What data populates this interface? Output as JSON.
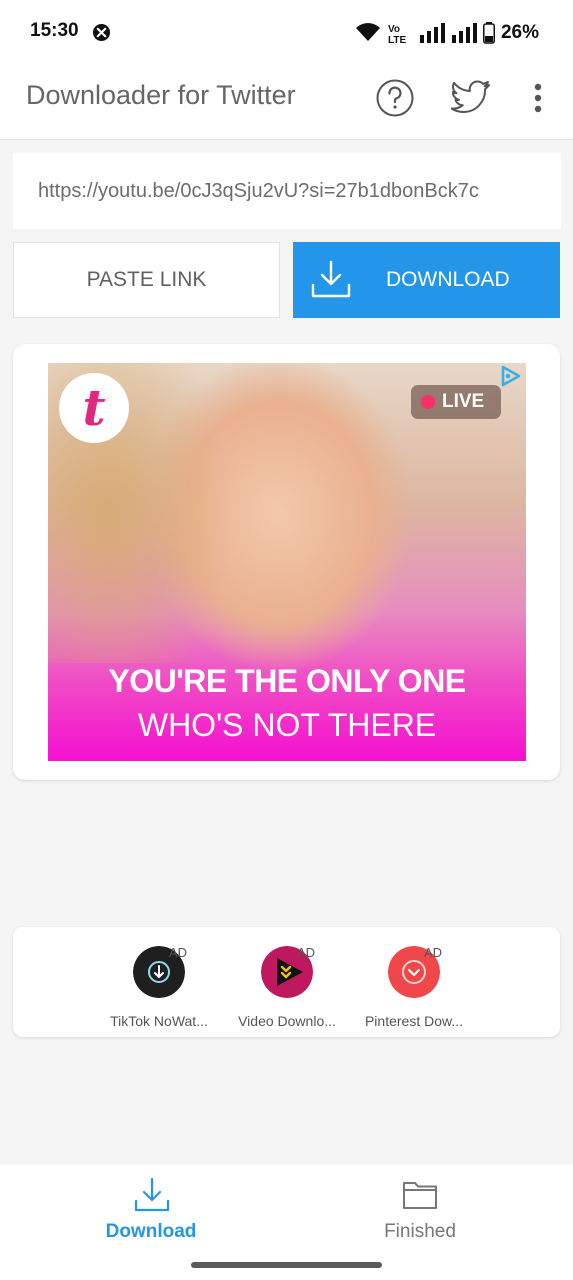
{
  "status_bar": {
    "time": "15:30",
    "battery": "26%",
    "icons": [
      "notification-icon",
      "wifi-icon",
      "volte-icon",
      "signal-icon",
      "battery-icon"
    ]
  },
  "app_bar": {
    "title": "Downloader for Twitter",
    "actions": [
      "help-icon",
      "twitter-bird-icon",
      "overflow-menu-icon"
    ]
  },
  "url_input": {
    "value": "https://youtu.be/0cJ3qSju2vU?si=27b1dbonBck7c"
  },
  "buttons": {
    "paste_label": "PASTE LINK",
    "download_label": "DOWNLOAD"
  },
  "ad": {
    "logo_letter": "t",
    "live_label": "LIVE",
    "headline_line1": "YOU'RE THE ONLY ONE",
    "headline_line2": "WHO'S NOT THERE"
  },
  "promo_apps": [
    {
      "label": "TikTok NoWat...",
      "badge": "AD",
      "color": "#1f1f1f"
    },
    {
      "label": "Video Downlo...",
      "badge": "AD",
      "color": "#c0185e"
    },
    {
      "label": "Pinterest Dow...",
      "badge": "AD",
      "color": "#f0484a"
    }
  ],
  "bottom_nav": {
    "download_label": "Download",
    "finished_label": "Finished",
    "active": "download",
    "active_color": "#2496ea",
    "inactive_color": "#777777"
  }
}
